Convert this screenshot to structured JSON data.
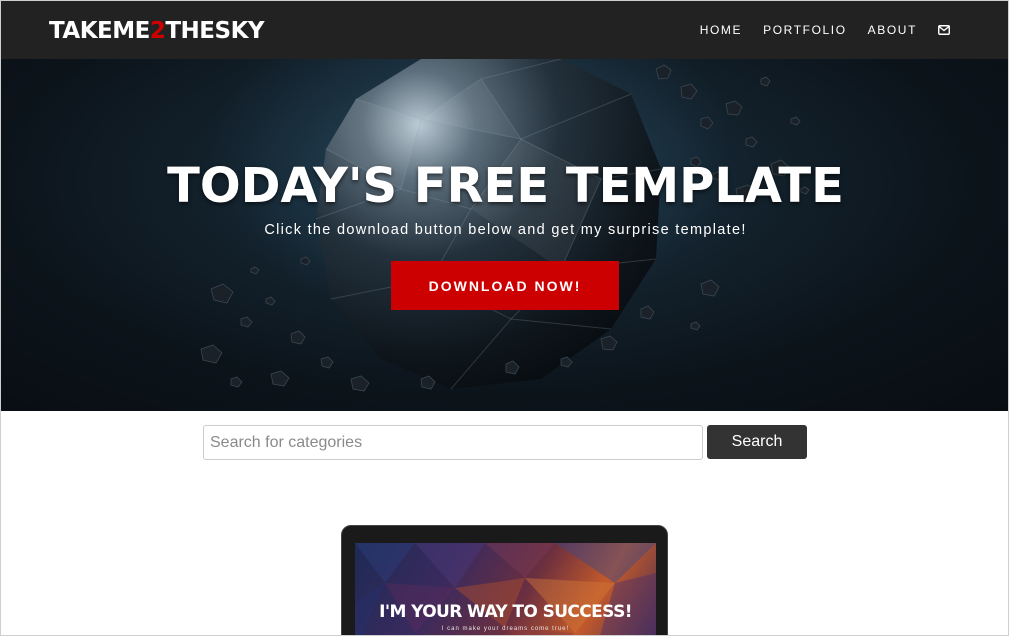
{
  "navbar": {
    "brand_prefix": "TAKEME",
    "brand_accent": "2",
    "brand_suffix": "THESKY",
    "links": [
      "HOME",
      "PORTFOLIO",
      "ABOUT"
    ],
    "mail_icon": "envelope-icon"
  },
  "hero": {
    "title": "TODAY'S FREE TEMPLATE",
    "subtitle": "Click the download button below and get my surprise template!",
    "button_label": "DOWNLOAD NOW!"
  },
  "search": {
    "placeholder": "Search for categories",
    "value": "",
    "button_label": "Search"
  },
  "preview": {
    "headline": "I'M YOUR WAY TO SUCCESS!",
    "tagline": "I can make your dreams come true!"
  },
  "colors": {
    "navbar_bg": "#222222",
    "accent_red": "#cc0000",
    "search_button_bg": "#333333"
  }
}
